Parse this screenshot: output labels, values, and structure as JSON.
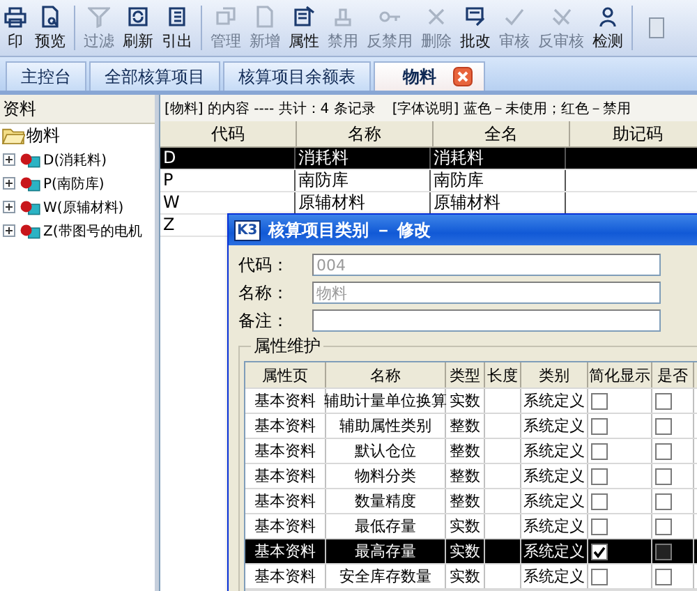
{
  "toolbar": {
    "groups": [
      [
        {
          "label": "印",
          "disabled": false
        },
        {
          "label": "预览",
          "disabled": false
        }
      ],
      [
        {
          "label": "过滤",
          "disabled": true
        },
        {
          "label": "刷新",
          "disabled": false
        },
        {
          "label": "引出",
          "disabled": false
        }
      ],
      [
        {
          "label": "管理",
          "disabled": true
        },
        {
          "label": "新增",
          "disabled": true
        },
        {
          "label": "属性",
          "disabled": false
        },
        {
          "label": "禁用",
          "disabled": true
        },
        {
          "label": "反禁用",
          "disabled": true
        },
        {
          "label": "删除",
          "disabled": true
        },
        {
          "label": "批改",
          "disabled": false
        },
        {
          "label": "审核",
          "disabled": true
        },
        {
          "label": "反审核",
          "disabled": true
        },
        {
          "label": "检测",
          "disabled": false
        }
      ]
    ]
  },
  "tabs": [
    {
      "label": "主控台",
      "selected": false
    },
    {
      "label": "全部核算项目",
      "selected": false
    },
    {
      "label": "核算项目余额表",
      "selected": false
    },
    {
      "label": "物料",
      "selected": true
    }
  ],
  "sidebar": {
    "header": "资料",
    "tree": [
      {
        "label": "物料",
        "expanded": true,
        "children": [
          {
            "label": "D(消耗料)",
            "expanded": false
          },
          {
            "label": "P(南防库)",
            "expanded": false
          },
          {
            "label": "W(原辅材料)",
            "expanded": false
          },
          {
            "label": "Z(带图号的电机",
            "expanded": false
          }
        ]
      }
    ]
  },
  "content": {
    "summary": "[物料] 的内容 ---- 共计：4 条记录",
    "legend": "[字体说明] 蓝色－未使用；红色－禁用",
    "table": {
      "columns": [
        "代码",
        "名称",
        "全名",
        "助记码"
      ],
      "rows": [
        {
          "cells": [
            "D",
            "消耗料",
            "消耗料"
          ],
          "selected": true
        },
        {
          "cells": [
            "P",
            "南防库",
            "南防库"
          ],
          "selected": false
        },
        {
          "cells": [
            "W",
            "原辅材料",
            "原辅材料"
          ],
          "selected": false
        },
        {
          "cells": [
            "Z"
          ],
          "selected": false
        }
      ]
    }
  },
  "dialog": {
    "logo": "K3",
    "title": "核算项目类别 － 修改",
    "fields": [
      {
        "label": "代码：",
        "value": "004",
        "disabled": true
      },
      {
        "label": "名称：",
        "value": "物料",
        "disabled": true
      },
      {
        "label": "备注："
      }
    ],
    "group_title": "属性维护",
    "grid": {
      "columns": [
        "属性页",
        "名称",
        "类型",
        "长度",
        "类别",
        "简化显示",
        "是否"
      ],
      "rows": [
        {
          "cells": [
            "基本资料",
            "辅助计量单位换算",
            "实数",
            "",
            "系统定义"
          ],
          "simplified": false,
          "column_7": false,
          "selected": false
        },
        {
          "cells": [
            "基本资料",
            "辅助属性类别",
            "整数",
            "",
            "系统定义"
          ],
          "simplified": false,
          "column_7": false,
          "selected": false
        },
        {
          "cells": [
            "基本资料",
            "默认仓位",
            "整数",
            "",
            "系统定义"
          ],
          "simplified": false,
          "column_7": false,
          "selected": false
        },
        {
          "cells": [
            "基本资料",
            "物料分类",
            "整数",
            "",
            "系统定义"
          ],
          "simplified": false,
          "column_7": false,
          "selected": false
        },
        {
          "cells": [
            "基本资料",
            "数量精度",
            "整数",
            "",
            "系统定义"
          ],
          "simplified": false,
          "column_7": false,
          "selected": false
        },
        {
          "cells": [
            "基本资料",
            "最低存量",
            "实数",
            "",
            "系统定义"
          ],
          "simplified": false,
          "column_7": false,
          "selected": false
        },
        {
          "cells": [
            "基本资料",
            "最高存量",
            "实数",
            "",
            "系统定义"
          ],
          "simplified": true,
          "column_7": false,
          "selected": true
        },
        {
          "cells": [
            "基本资料",
            "安全库存数量",
            "实数",
            "",
            "系统定义"
          ],
          "simplified": false,
          "column_7": false,
          "selected": false
        }
      ]
    }
  }
}
